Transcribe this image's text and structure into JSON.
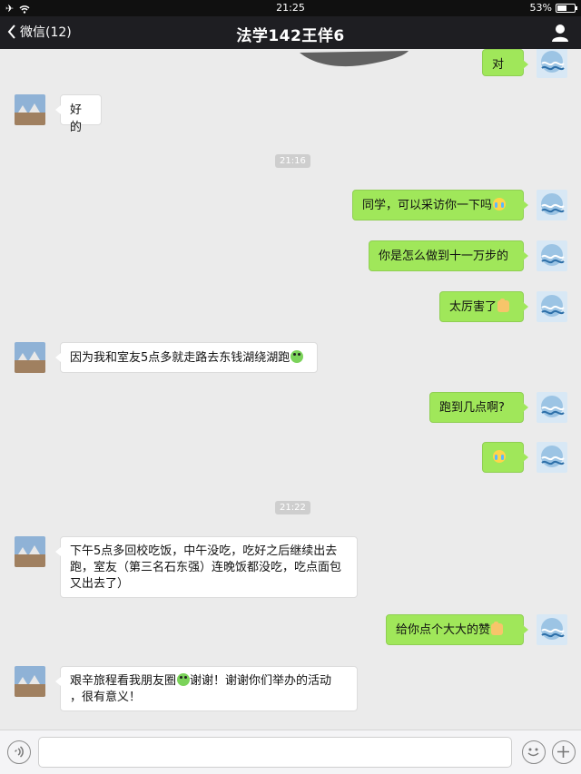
{
  "status_bar": {
    "time": "21:25",
    "battery": "53%",
    "battery_level": 0.53
  },
  "nav": {
    "back_label": "微信(12)",
    "title": "法学142王佯6"
  },
  "messages": [
    {
      "side": "right",
      "text": "对"
    },
    {
      "side": "left",
      "text": "好的"
    },
    {
      "type": "time",
      "text": "21:16"
    },
    {
      "side": "right",
      "text": "同学，可以采访你一下吗",
      "emoji": "cry"
    },
    {
      "side": "right",
      "text": "你是怎么做到十一万步的"
    },
    {
      "side": "right",
      "text": "太厉害了",
      "emoji": "thumb"
    },
    {
      "side": "left",
      "text": "因为我和室友5点多就走路去东钱湖绕湖跑",
      "emoji": "frog"
    },
    {
      "side": "right",
      "text": "跑到几点啊?"
    },
    {
      "side": "right",
      "text": "",
      "emoji": "cry"
    },
    {
      "type": "time",
      "text": "21:22"
    },
    {
      "side": "left",
      "lines": [
        "下午5点多回校吃饭，中午没吃，吃好之后继续出去",
        "跑，室友（第三名石东强）连晚饭都没吃，吃点面包",
        "又出去了）"
      ]
    },
    {
      "side": "right",
      "text": "给你点个大大的赞",
      "emoji": "thumb"
    },
    {
      "side": "left",
      "line1": "艰辛旅程看我朋友圈",
      "line1_after": "谢谢！谢谢你们举办的活动",
      "line2": "，很有意义！"
    }
  ],
  "input": {
    "placeholder": ""
  },
  "colors": {
    "nav_bg": "#1e1e22",
    "chat_bg": "#ebebeb",
    "bubble_right": "#a0e75a",
    "bubble_left": "#ffffff"
  },
  "icons": [
    "back-chevron-icon",
    "profile-icon",
    "voice-icon",
    "emoji-icon",
    "plus-icon",
    "airplane-icon",
    "wifi-icon"
  ]
}
